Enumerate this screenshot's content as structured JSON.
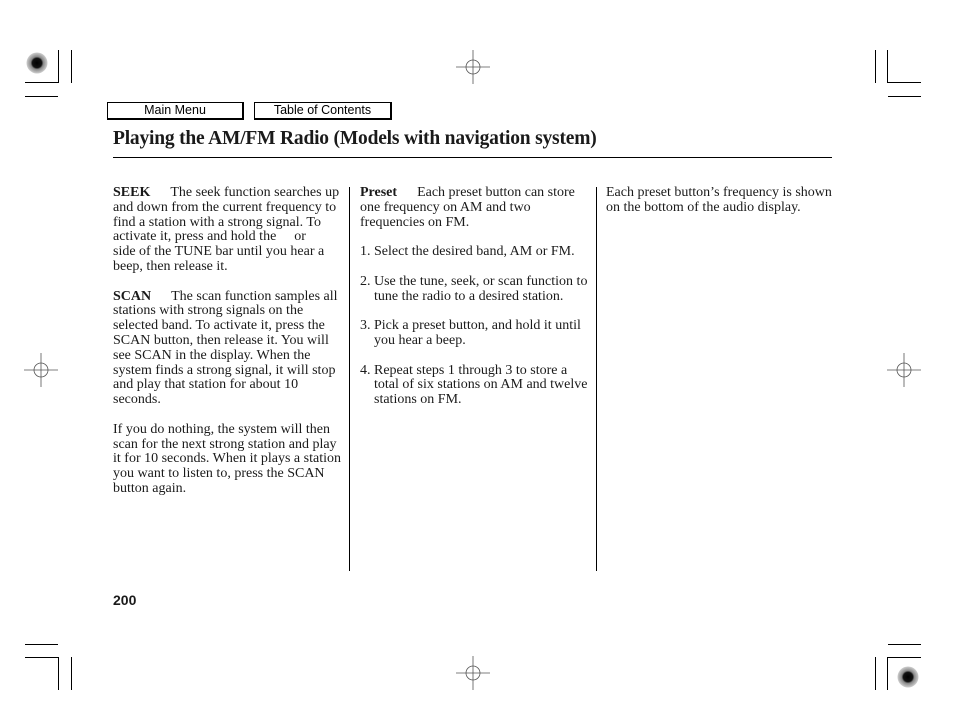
{
  "nav": {
    "main_menu": "Main Menu",
    "table_of_contents": "Table of Contents"
  },
  "page": {
    "title": "Playing the AM/FM Radio (Models with navigation system)",
    "page_number": "200"
  },
  "column1": {
    "seek": {
      "label": "SEEK",
      "text_before": "The seek function searches up and down from the current frequency to find a station with a strong signal. To activate it, press and hold the",
      "text_or": "or",
      "text_after": "side of the TUNE bar until you hear a beep, then release it."
    },
    "scan": {
      "label": "SCAN",
      "text": "The scan function samples all stations with strong signals on the selected band. To activate it, press the SCAN button, then release it. You will see SCAN in the display. When the system finds a strong signal, it will stop and play that station for about 10 seconds."
    },
    "scan_followup": "If you do nothing, the system will then scan for the next strong station and play it for 10 seconds. When it plays a station you want to listen to, press the SCAN button again."
  },
  "column2": {
    "preset": {
      "label": "Preset",
      "text": "Each preset button can store one frequency on AM and two frequencies on FM."
    },
    "steps": [
      {
        "num": "1.",
        "text": "Select the desired band, AM or FM."
      },
      {
        "num": "2.",
        "text": "Use the tune, seek, or scan function to tune the radio to a desired station."
      },
      {
        "num": "3.",
        "text": "Pick a preset button, and hold it until you hear a beep."
      },
      {
        "num": "4.",
        "text": "Repeat steps 1 through 3 to store a total of six stations on AM and twelve stations on FM."
      }
    ]
  },
  "column3": {
    "text": "Each preset button’s frequency is shown on the bottom of the audio display."
  }
}
